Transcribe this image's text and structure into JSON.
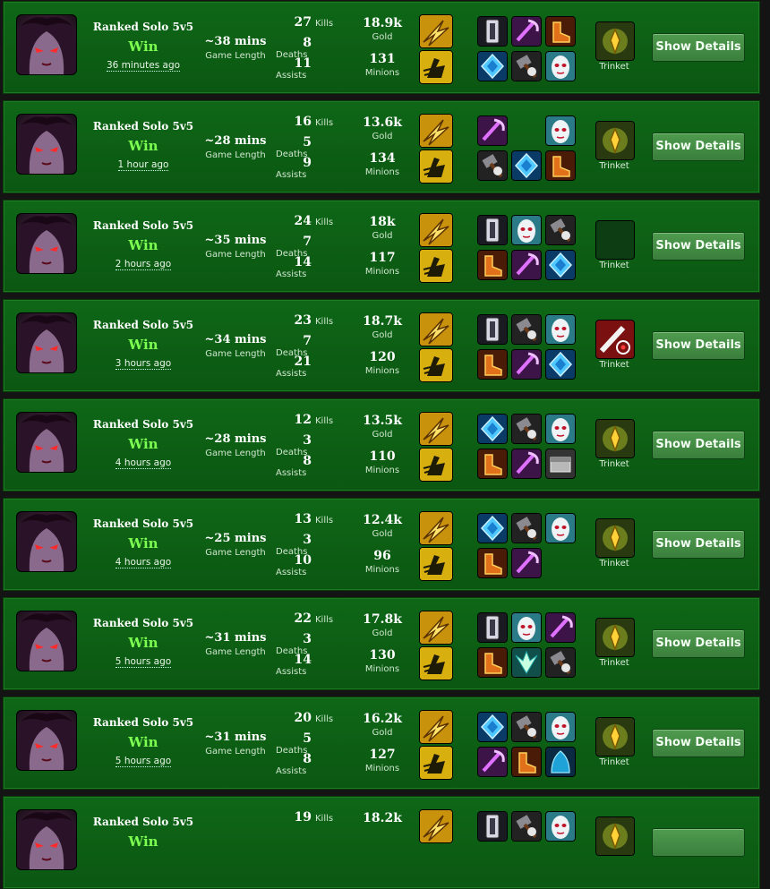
{
  "matches": [
    {
      "queue": "Ranked Solo 5v5",
      "result": "Win",
      "ago": "36 minutes ago",
      "length": "~38 mins",
      "length_label": "Game Length",
      "kills": "27",
      "deaths": "8",
      "assists": "11",
      "kills_label": "Kills",
      "deaths_label": "Deaths",
      "assists_label": "Assists",
      "gold": "18.9k",
      "gold_label": "Gold",
      "minions": "131",
      "minions_label": "Minions",
      "trinket_label": "Trinket",
      "details_label": "Show Details",
      "spells": [
        "flash-icon",
        "ghost-icon"
      ],
      "items": [
        "armor-icon",
        "scythe-icon",
        "boots-icon",
        "crystal-icon",
        "hammer-icon",
        "mask-icon"
      ],
      "trinket": "yellow-totem-icon"
    },
    {
      "queue": "Ranked Solo 5v5",
      "result": "Win",
      "ago": "1 hour ago",
      "length": "~28 mins",
      "length_label": "Game Length",
      "kills": "16",
      "deaths": "5",
      "assists": "9",
      "kills_label": "Kills",
      "deaths_label": "Deaths",
      "assists_label": "Assists",
      "gold": "13.6k",
      "gold_label": "Gold",
      "minions": "134",
      "minions_label": "Minions",
      "trinket_label": "Trinket",
      "details_label": "Show Details",
      "spells": [
        "flash-icon",
        "ghost-icon"
      ],
      "items": [
        "scythe-icon",
        "",
        "mask-icon",
        "hammer-icon",
        "crystal-icon",
        "boots-icon"
      ],
      "trinket": "yellow-totem-icon"
    },
    {
      "queue": "Ranked Solo 5v5",
      "result": "Win",
      "ago": "2 hours ago",
      "length": "~35 mins",
      "length_label": "Game Length",
      "kills": "24",
      "deaths": "7",
      "assists": "14",
      "kills_label": "Kills",
      "deaths_label": "Deaths",
      "assists_label": "Assists",
      "gold": "18k",
      "gold_label": "Gold",
      "minions": "117",
      "minions_label": "Minions",
      "trinket_label": "Trinket",
      "details_label": "Show Details",
      "spells": [
        "flash-icon",
        "ghost-icon"
      ],
      "items": [
        "armor-icon",
        "mask-icon",
        "hammer-icon",
        "boots-icon",
        "scythe-icon",
        "crystal-icon"
      ],
      "trinket": "empty-slot-icon"
    },
    {
      "queue": "Ranked Solo 5v5",
      "result": "Win",
      "ago": "3 hours ago",
      "length": "~34 mins",
      "length_label": "Game Length",
      "kills": "23",
      "deaths": "7",
      "assists": "21",
      "kills_label": "Kills",
      "deaths_label": "Deaths",
      "assists_label": "Assists",
      "gold": "18.7k",
      "gold_label": "Gold",
      "minions": "120",
      "minions_label": "Minions",
      "trinket_label": "Trinket",
      "details_label": "Show Details",
      "spells": [
        "flash-icon",
        "ghost-icon"
      ],
      "items": [
        "armor-icon",
        "hammer-icon",
        "mask-icon",
        "boots-icon",
        "scythe-icon",
        "crystal-icon"
      ],
      "trinket": "red-lens-icon"
    },
    {
      "queue": "Ranked Solo 5v5",
      "result": "Win",
      "ago": "4 hours ago",
      "length": "~28 mins",
      "length_label": "Game Length",
      "kills": "12",
      "deaths": "3",
      "assists": "8",
      "kills_label": "Kills",
      "deaths_label": "Deaths",
      "assists_label": "Assists",
      "gold": "13.5k",
      "gold_label": "Gold",
      "minions": "110",
      "minions_label": "Minions",
      "trinket_label": "Trinket",
      "details_label": "Show Details",
      "spells": [
        "flash-icon",
        "ghost-icon"
      ],
      "items": [
        "crystal-icon",
        "hammer-icon",
        "mask-icon",
        "boots-icon",
        "scythe-icon",
        "chest-icon"
      ],
      "trinket": "yellow-totem-icon"
    },
    {
      "queue": "Ranked Solo 5v5",
      "result": "Win",
      "ago": "4 hours ago",
      "length": "~25 mins",
      "length_label": "Game Length",
      "kills": "13",
      "deaths": "3",
      "assists": "10",
      "kills_label": "Kills",
      "deaths_label": "Deaths",
      "assists_label": "Assists",
      "gold": "12.4k",
      "gold_label": "Gold",
      "minions": "96",
      "minions_label": "Minions",
      "trinket_label": "Trinket",
      "details_label": "Show Details",
      "spells": [
        "flash-icon",
        "ghost-icon"
      ],
      "items": [
        "crystal-icon",
        "hammer-icon",
        "mask-icon",
        "boots-icon",
        "scythe-icon",
        ""
      ],
      "trinket": "yellow-totem-icon"
    },
    {
      "queue": "Ranked Solo 5v5",
      "result": "Win",
      "ago": "5 hours ago",
      "length": "~31 mins",
      "length_label": "Game Length",
      "kills": "22",
      "deaths": "3",
      "assists": "14",
      "kills_label": "Kills",
      "deaths_label": "Deaths",
      "assists_label": "Assists",
      "gold": "17.8k",
      "gold_label": "Gold",
      "minions": "130",
      "minions_label": "Minions",
      "trinket_label": "Trinket",
      "details_label": "Show Details",
      "spells": [
        "flash-icon",
        "ghost-icon"
      ],
      "items": [
        "armor-icon",
        "mask-icon",
        "scythe-icon",
        "boots-icon",
        "wings-icon",
        "hammer-icon"
      ],
      "trinket": "yellow-totem-icon"
    },
    {
      "queue": "Ranked Solo 5v5",
      "result": "Win",
      "ago": "5 hours ago",
      "length": "~31 mins",
      "length_label": "Game Length",
      "kills": "20",
      "deaths": "5",
      "assists": "8",
      "kills_label": "Kills",
      "deaths_label": "Deaths",
      "assists_label": "Assists",
      "gold": "16.2k",
      "gold_label": "Gold",
      "minions": "127",
      "minions_label": "Minions",
      "trinket_label": "Trinket",
      "details_label": "Show Details",
      "spells": [
        "flash-icon",
        "ghost-icon"
      ],
      "items": [
        "crystal-icon",
        "hammer-icon",
        "mask-icon",
        "scythe-icon",
        "boots-icon",
        "cloak-icon"
      ],
      "trinket": "yellow-totem-icon"
    },
    {
      "queue": "Ranked Solo 5v5",
      "result": "Win",
      "ago": "",
      "length": "",
      "length_label": "",
      "kills": "19",
      "deaths": "",
      "assists": "",
      "kills_label": "Kills",
      "deaths_label": "",
      "assists_label": "",
      "gold": "18.2k",
      "gold_label": "",
      "minions": "",
      "minions_label": "",
      "trinket_label": "",
      "details_label": "",
      "spells": [
        "flash-icon"
      ],
      "items": [
        "armor-icon",
        "hammer-icon",
        "mask-icon"
      ],
      "trinket": "yellow-totem-icon"
    }
  ],
  "colors": {
    "row_bg": "#0f6717",
    "win": "#7dff52",
    "button": "#4a944a"
  }
}
